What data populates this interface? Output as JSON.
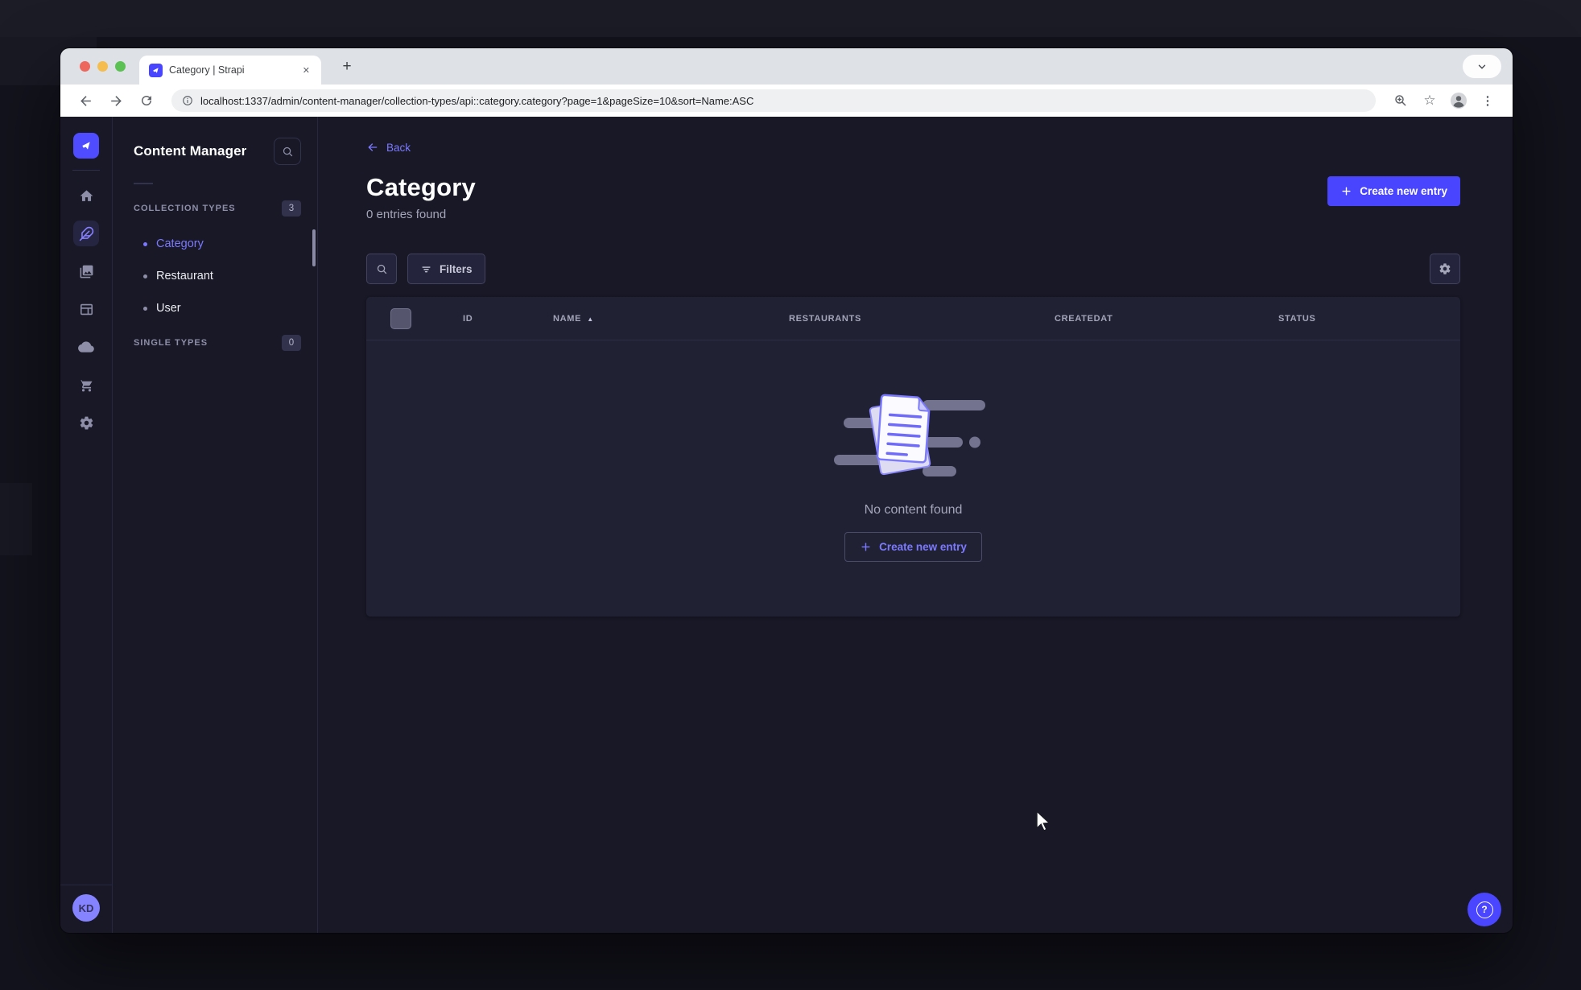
{
  "colors": {
    "primary": "#4945ff",
    "link": "#7b79ff",
    "page_bg": "#181826",
    "card_bg": "#212134",
    "traffic_red": "#ee675c",
    "traffic_yellow": "#f4bd4e",
    "traffic_green": "#5bc152"
  },
  "icons": {
    "close": "✕",
    "new_tab": "+",
    "star": "☆",
    "overflow": "⋮",
    "sort_asc": "▲",
    "back_arrow": "←",
    "help": "?"
  },
  "browser": {
    "tab_title": "Category | Strapi",
    "url": "localhost:1337/admin/content-manager/collection-types/api::category.category?page=1&pageSize=10&sort=Name:ASC"
  },
  "sidebar": {
    "avatar_initials": "KD",
    "nav_items": [
      {
        "name": "home"
      },
      {
        "name": "content-manager",
        "active": true
      },
      {
        "name": "media-library"
      },
      {
        "name": "content-type-builder"
      },
      {
        "name": "cloud"
      },
      {
        "name": "marketplace"
      },
      {
        "name": "settings"
      }
    ]
  },
  "panel": {
    "title": "Content Manager",
    "sections": [
      {
        "label": "COLLECTION TYPES",
        "badge": "3",
        "items": [
          {
            "label": "Category",
            "active": true
          },
          {
            "label": "Restaurant",
            "active": false
          },
          {
            "label": "User",
            "active": false
          }
        ]
      },
      {
        "label": "SINGLE TYPES",
        "badge": "0",
        "items": []
      }
    ]
  },
  "main": {
    "back_label": "Back",
    "title": "Category",
    "subtitle": "0 entries found",
    "create_button_label": "Create new entry",
    "filters_label": "Filters",
    "table": {
      "headers": [
        "ID",
        "NAME",
        "RESTAURANTS",
        "CREATEDAT",
        "STATUS"
      ],
      "sorted_column": "NAME",
      "sort_direction": "ASC"
    },
    "empty_state": {
      "message": "No content found",
      "cta_label": "Create new entry"
    }
  }
}
